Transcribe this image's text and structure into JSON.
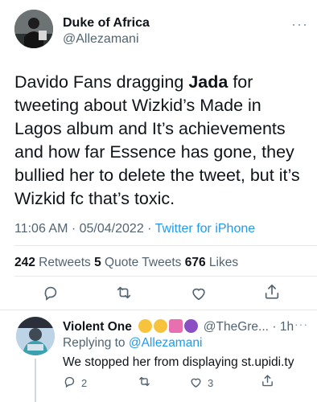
{
  "tweet": {
    "author_name": "Duke of Africa",
    "author_handle": "@Allezamani",
    "more": "···",
    "text_before": "Davido Fans dragging ",
    "text_bold": "Jada",
    "text_after": " for tweeting about Wizkid’s Made in Lagos album and It’s achievements and how far Essence has gone, they bullied her to delete the tweet, but it’s Wizkid fc that’s toxic.",
    "time": "11:06 AM · 05/04/2022 · ",
    "source": "Twitter for iPhone",
    "retweets_count": "242",
    "retweets_label": " Retweets ",
    "quotes_count": "5",
    "quotes_label": " Quote Tweets ",
    "likes_count": "676",
    "likes_label": " Likes"
  },
  "reply": {
    "author_name": "Violent One",
    "author_handle": "@TheGre...",
    "time": "· 1h",
    "more": "···",
    "replying_prefix": "Replying to ",
    "replying_to": "@Allezamani",
    "text": "We stopped her from displaying st.upidi.ty",
    "reply_count": "2",
    "like_count": "3"
  },
  "colors": {
    "accent": "#1d9bf0",
    "secondary_text": "#536471",
    "primary_text": "#0f1419",
    "divider": "#e6e9ec"
  },
  "icons": [
    "reply-icon",
    "retweet-icon",
    "like-icon",
    "share-icon",
    "more-icon"
  ]
}
